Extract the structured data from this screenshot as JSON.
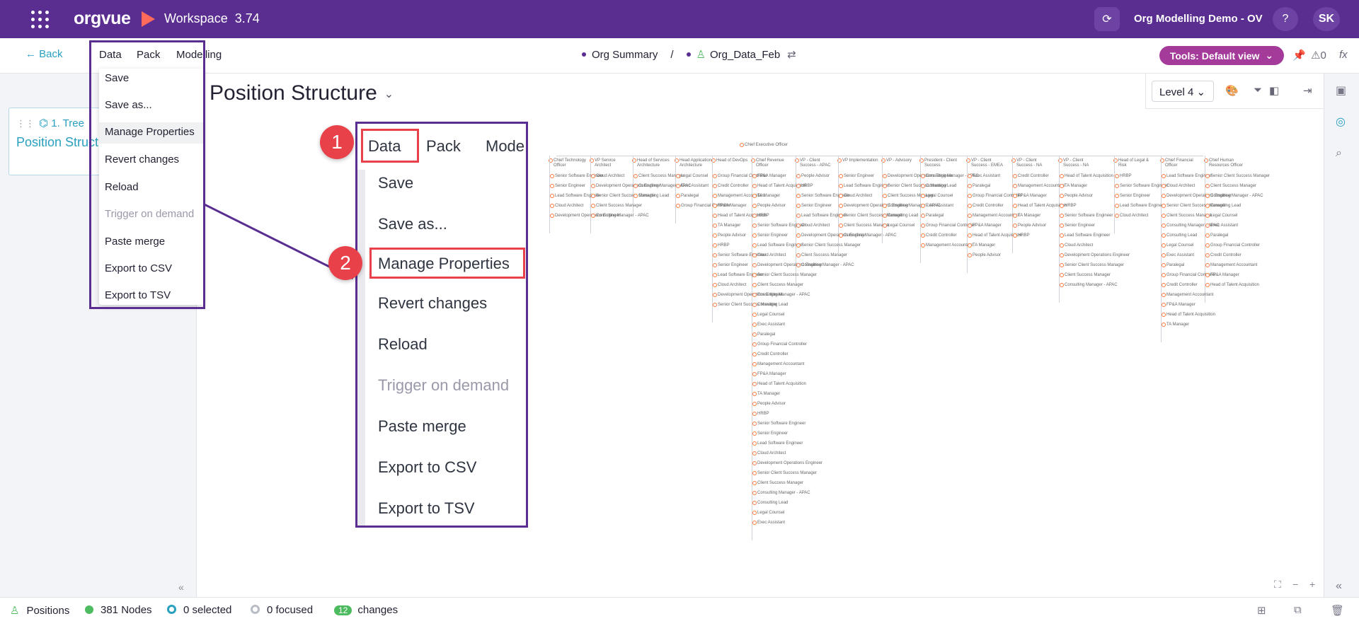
{
  "app": {
    "logo": "orgvue",
    "workspace_label": "Workspace",
    "version": "3.74",
    "org_name": "Org Modelling Demo - OV",
    "help": "?",
    "avatar": "SK"
  },
  "subbar": {
    "back": "Back",
    "menus": [
      "Data",
      "Pack",
      "Modelling"
    ],
    "crumbs": [
      "Org Summary",
      "Org_Data_Feb"
    ],
    "crumb_sep": "/",
    "tools": "Tools: Default view",
    "pin_count": "0",
    "fx": "fx"
  },
  "data_menu": {
    "items": [
      "Save",
      "Save as...",
      "Manage Properties",
      "Revert changes",
      "Reload",
      "Trigger on demand",
      "Paste merge",
      "Export to CSV",
      "Export to TSV"
    ],
    "disabled": [
      "Trigger on demand"
    ],
    "highlighted": "Manage Properties"
  },
  "left_panel": {
    "card_tree": "1. Tree",
    "card_title": "Position Structure"
  },
  "main": {
    "title": "Position Structure",
    "level": "Level 4"
  },
  "zoom_callout": {
    "menus": [
      "Data",
      "Pack",
      "Mode"
    ],
    "step1": "1",
    "step2": "2"
  },
  "org_chart": {
    "root": "Chief Executive Officer",
    "top_level": [
      "Chief Technology Officer",
      "VP Service Architect",
      "Head of Services Architecture",
      "Head Application Architecture",
      "Head of DevOps",
      "Chief Revenue Officer",
      "VP - Client Success - APAC",
      "VP Implementation",
      "VP - Advisory",
      "President - Client Success",
      "VP - Client Success - EMEA",
      "VP - Client Success - NA",
      "VP - Client Success - NA",
      "Head of Legal & Risk",
      "Chief Financial Officer",
      "Chief Human Resources Officer"
    ],
    "sample_children": [
      "Senior Software Engineer",
      "Senior Engineer",
      "Lead Software Engineer",
      "Cloud Architect",
      "Development Operations Engineer",
      "Senior Client Success Manager",
      "Client Success Manager",
      "Consulting Manager - APAC",
      "Consulting Lead",
      "Legal Counsel",
      "Exec Assistant",
      "Paralegal",
      "Group Financial Controller",
      "Credit Controller",
      "Management Accountant",
      "FP&A Manager",
      "Head of Talent Acquisition",
      "TA Manager",
      "People Advisor",
      "HRBP"
    ]
  },
  "status": {
    "positions": "Positions",
    "nodes": "381 Nodes",
    "selected": "0 selected",
    "focused": "0 focused",
    "changes_count": "12",
    "changes": "changes"
  },
  "colors": {
    "brand": "#5a2d91",
    "tools": "#a43a9a",
    "accent": "#2aa0c0",
    "highlight_red": "#e8414a",
    "changes_green": "#4dbb5f"
  }
}
